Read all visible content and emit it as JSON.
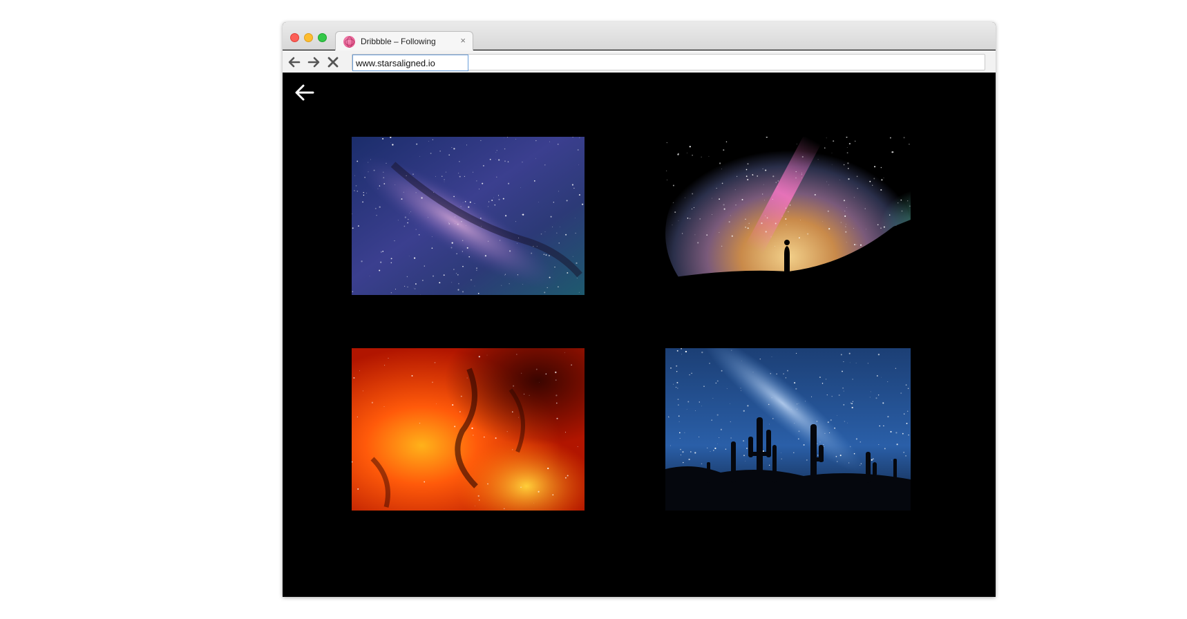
{
  "browser": {
    "tab": {
      "title": "Dribbble – Following",
      "favicon": "dribbble-icon",
      "close_glyph": "×"
    },
    "url": "www.starsaligned.io",
    "nav_icons": [
      "back-arrow-icon",
      "forward-arrow-icon",
      "stop-icon"
    ]
  },
  "page": {
    "back_icon": "back-arrow-icon",
    "gallery": [
      {
        "name": "photo-milky-way-purple",
        "description_icon": "image"
      },
      {
        "name": "photo-aurora-silhouette",
        "description_icon": "image"
      },
      {
        "name": "photo-red-nebula",
        "description_icon": "image"
      },
      {
        "name": "photo-cactus-night-sky",
        "description_icon": "image"
      }
    ]
  },
  "colors": {
    "background": "#000000",
    "url_focus": "#6a9ed9",
    "favicon": "#e2457f"
  }
}
